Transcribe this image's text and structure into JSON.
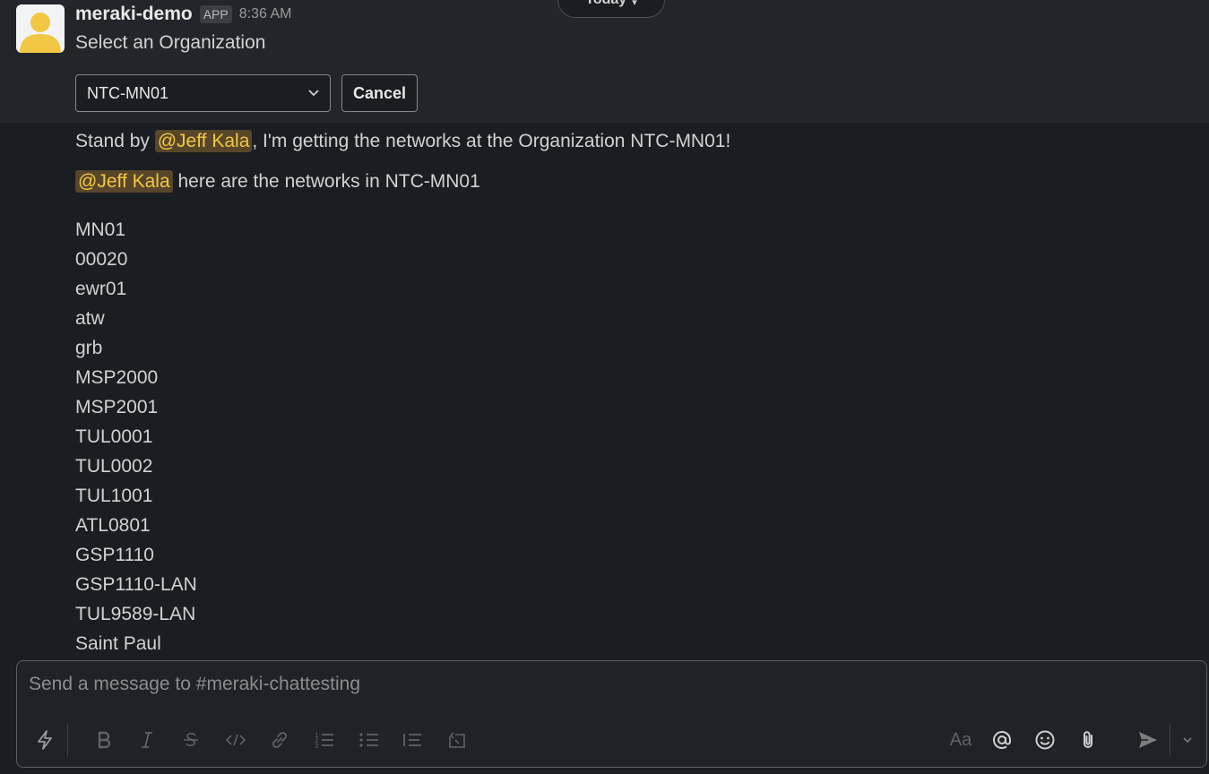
{
  "day_divider": {
    "label": "Today"
  },
  "message": {
    "sender": "meraki-demo",
    "badge": "APP",
    "time": "8:36 AM",
    "prompt": "Select an Organization",
    "select_value": "NTC-MN01",
    "cancel_label": "Cancel"
  },
  "replies": {
    "line1_prefix": "Stand by ",
    "line1_mention": "@Jeff Kala",
    "line1_suffix": ", I'm getting the networks at the Organization NTC-MN01!",
    "line2_mention": "@Jeff Kala",
    "line2_suffix": " here are the networks in NTC-MN01"
  },
  "networks": [
    "MN01",
    "00020",
    "ewr01",
    "atw",
    "grb",
    "MSP2000",
    "MSP2001",
    "TUL0001",
    "TUL0002",
    "TUL1001",
    "ATL0801",
    "GSP1110",
    "GSP1110-LAN",
    "TUL9589-LAN",
    "Saint Paul"
  ],
  "composer": {
    "placeholder": "Send a message to #meraki-chattesting",
    "format_label": "Aa"
  },
  "icons": {
    "shortcuts": "lightning-icon",
    "bold": "bold-icon",
    "italic": "italic-icon",
    "strike": "strikethrough-icon",
    "code": "code-icon",
    "link": "link-icon",
    "ordered": "ordered-list-icon",
    "bullet": "bullet-list-icon",
    "quote": "blockquote-icon",
    "codeblock": "code-block-icon",
    "mention": "at-icon",
    "emoji": "emoji-icon",
    "attach": "paperclip-icon",
    "send": "send-icon",
    "send_options": "chevron-down-icon"
  },
  "colors": {
    "background": "#1a1d21",
    "mention_bg": "#57462a",
    "mention_text": "#f2c744",
    "avatar": "#f2c744"
  }
}
